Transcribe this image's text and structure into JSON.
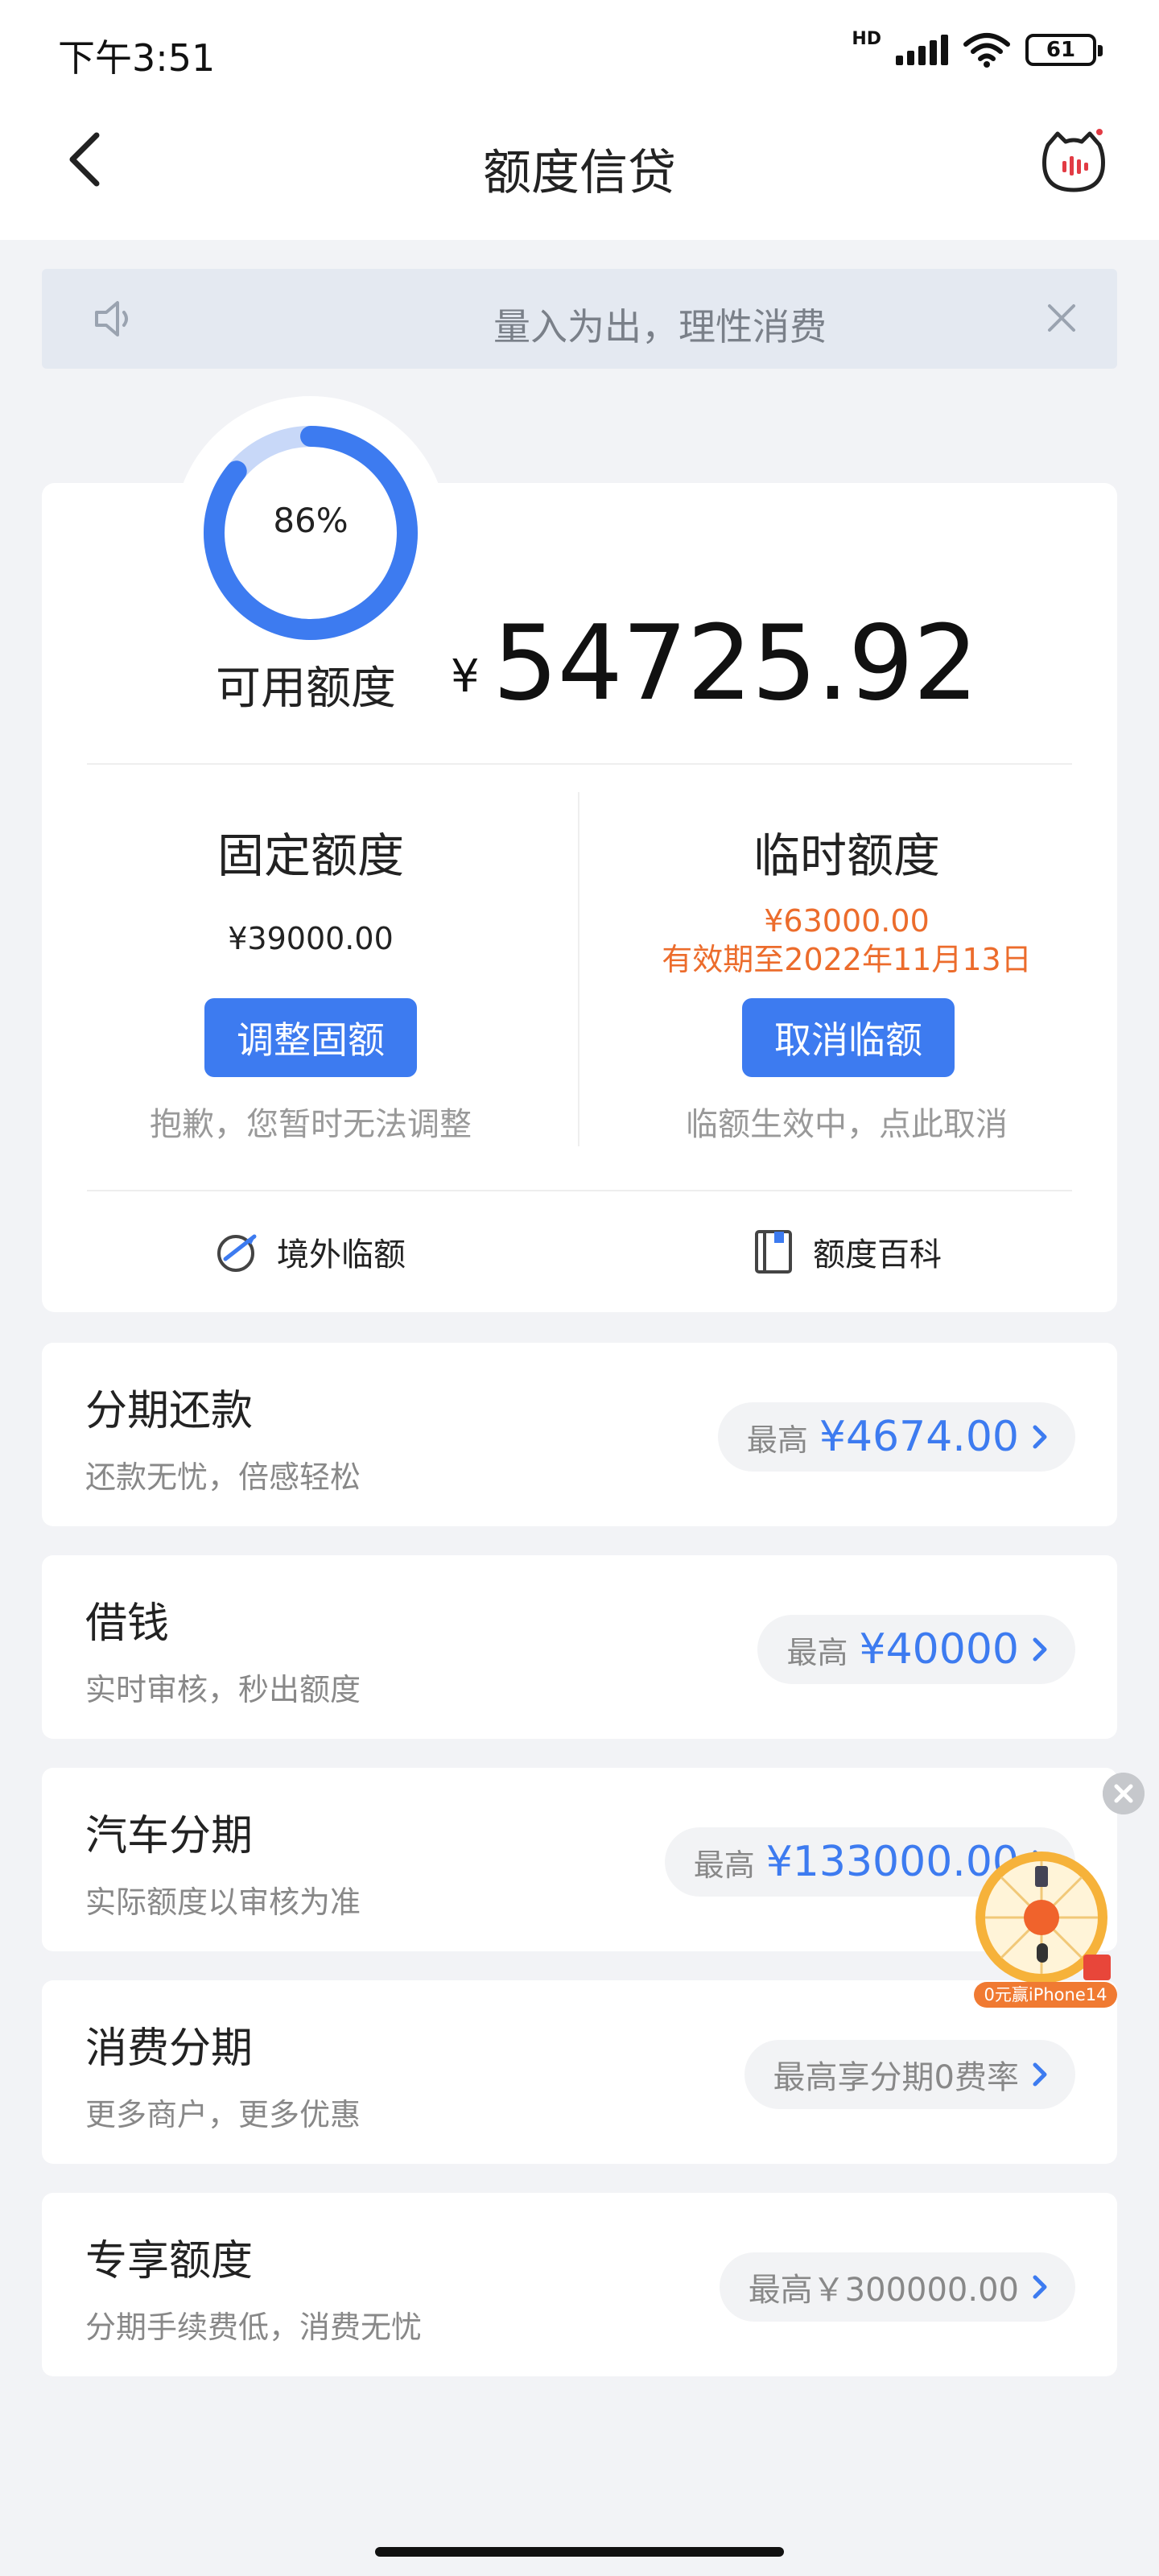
{
  "status": {
    "time": "下午3:51",
    "network": "HD",
    "battery": "61"
  },
  "header": {
    "title": "额度信贷"
  },
  "notice": {
    "text": "量入为出，理性消费"
  },
  "credit": {
    "percent_text": "86%",
    "percent": 0.86,
    "available_label": "可用额度",
    "currency": "¥",
    "available_amount": "54725.92",
    "fixed": {
      "title": "固定额度",
      "amount": "¥39000.00",
      "button": "调整固额",
      "hint": "抱歉，您暂时无法调整"
    },
    "temp": {
      "title": "临时额度",
      "amount": "¥63000.00",
      "validity": "有效期至2022年11月13日",
      "button": "取消临额",
      "hint": "临额生效中，点此取消"
    },
    "links": {
      "overseas": "境外临额",
      "wiki": "额度百科"
    }
  },
  "rows": [
    {
      "title": "分期还款",
      "sub": "还款无忧，倍感轻松",
      "prefix": "最高",
      "amount": "¥4674.00"
    },
    {
      "title": "借钱",
      "sub": "实时审核，秒出额度",
      "prefix": "最高",
      "amount": "¥40000"
    },
    {
      "title": "汽车分期",
      "sub": "实际额度以审核为准",
      "prefix": "最高",
      "amount": "¥133000.00"
    },
    {
      "title": "消费分期",
      "sub": "更多商户，更多优惠",
      "pill_text": "最高享分期0费率"
    },
    {
      "title": "专享额度",
      "sub": "分期手续费低，消费无忧",
      "pill_text": "最高￥300000.00"
    }
  ],
  "promo": {
    "label": "0元赢iPhone14"
  },
  "colors": {
    "accent": "#3d7bf0",
    "warning": "#ec6c2c",
    "ring_track": "#c8d8f8"
  }
}
